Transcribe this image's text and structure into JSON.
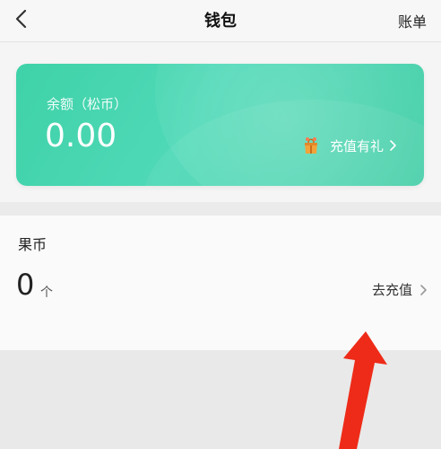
{
  "header": {
    "title": "钱包",
    "bill_label": "账单"
  },
  "balance_card": {
    "label": "余额（松币）",
    "amount": "0.00",
    "recharge_gift_label": "充值有礼",
    "gradient_colors": [
      "#3fd2a8",
      "#4fd9b7",
      "#46cfa8"
    ]
  },
  "coin_section": {
    "title": "果币",
    "count": "0",
    "unit": "个",
    "go_recharge_label": "去充值"
  },
  "icons": {
    "back": "chevron-left-icon",
    "gift": "gift-bag-icon",
    "chevron": "chevron-right-icon",
    "annotation": "red-arrow-icon"
  },
  "colors": {
    "accent_green": "#46cfa8",
    "annotation_red": "#ee2b18"
  }
}
